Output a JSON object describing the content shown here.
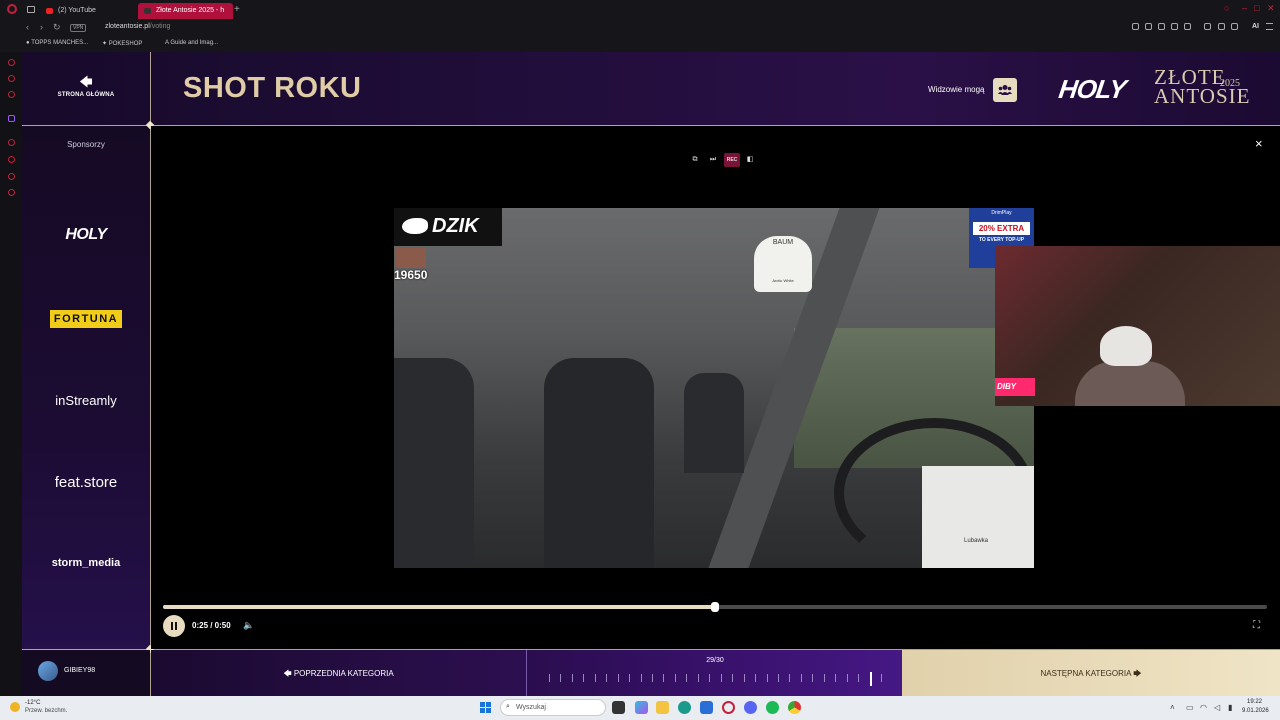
{
  "browser": {
    "tabs": [
      {
        "label": "(2) YouTube",
        "active": false
      },
      {
        "label": "Złote Antosie 2025 - h",
        "active": true
      }
    ],
    "new_tab": "+",
    "url_host": "zloteantosie.pl",
    "url_path": "/voting",
    "vpn_label": "VPN",
    "ai_label": "AI",
    "bookmarks": [
      "TOPPS MANCHES...",
      "POKESHOP",
      "A Guide and Imag..."
    ]
  },
  "header": {
    "home_label": "STRONA GŁÓWNA",
    "title": "SHOT ROKU",
    "viewers_label": "Widzowie mogą",
    "brand_holy": "HOLY",
    "brand_line1": "ZŁOTE",
    "brand_line2": "ANTOSIE",
    "brand_year": "2025"
  },
  "sidebar": {
    "sponsors_label": "Sponsorzy",
    "sponsors": [
      "HOLY",
      "FORTUNA",
      "inStreamly",
      "feat.store",
      "storm_media"
    ]
  },
  "player": {
    "close": "×",
    "controls": [
      "pip",
      "skip",
      "REC",
      "sidebar"
    ],
    "rec_label": "REC",
    "time": "0:25 / 0:50",
    "progress": 0.5,
    "video_overlay": {
      "logo": "DZIK",
      "score": "19650",
      "promo_top": "DrimPlay",
      "promo_main": "20% EXTRA",
      "promo_sub": "TO EVERY TOP-UP",
      "air_freshener_top": "BAUM",
      "air_freshener_bottom": "Arctic White",
      "map_label": "Lubawka",
      "cam_sign": "DIBY"
    }
  },
  "footer": {
    "username": "GIBIEY98",
    "prev_label": "POPRZEDNIA KATEGORIA",
    "pager_label": "29/30",
    "pager_current": 29,
    "pager_total": 30,
    "next_label": "NASTĘPNA KATEGORIA"
  },
  "taskbar": {
    "weather_temp": "-12°C",
    "weather_desc": "Przew. bezchm.",
    "search_placeholder": "Wyszukaj",
    "time": "19:22",
    "date": "9.01.2026"
  },
  "colors": {
    "accent_gold": "#e0cda6",
    "brand_purple": "#2a1047",
    "opera_red": "#c2203c",
    "fortuna_yellow": "#f1cd1a"
  }
}
